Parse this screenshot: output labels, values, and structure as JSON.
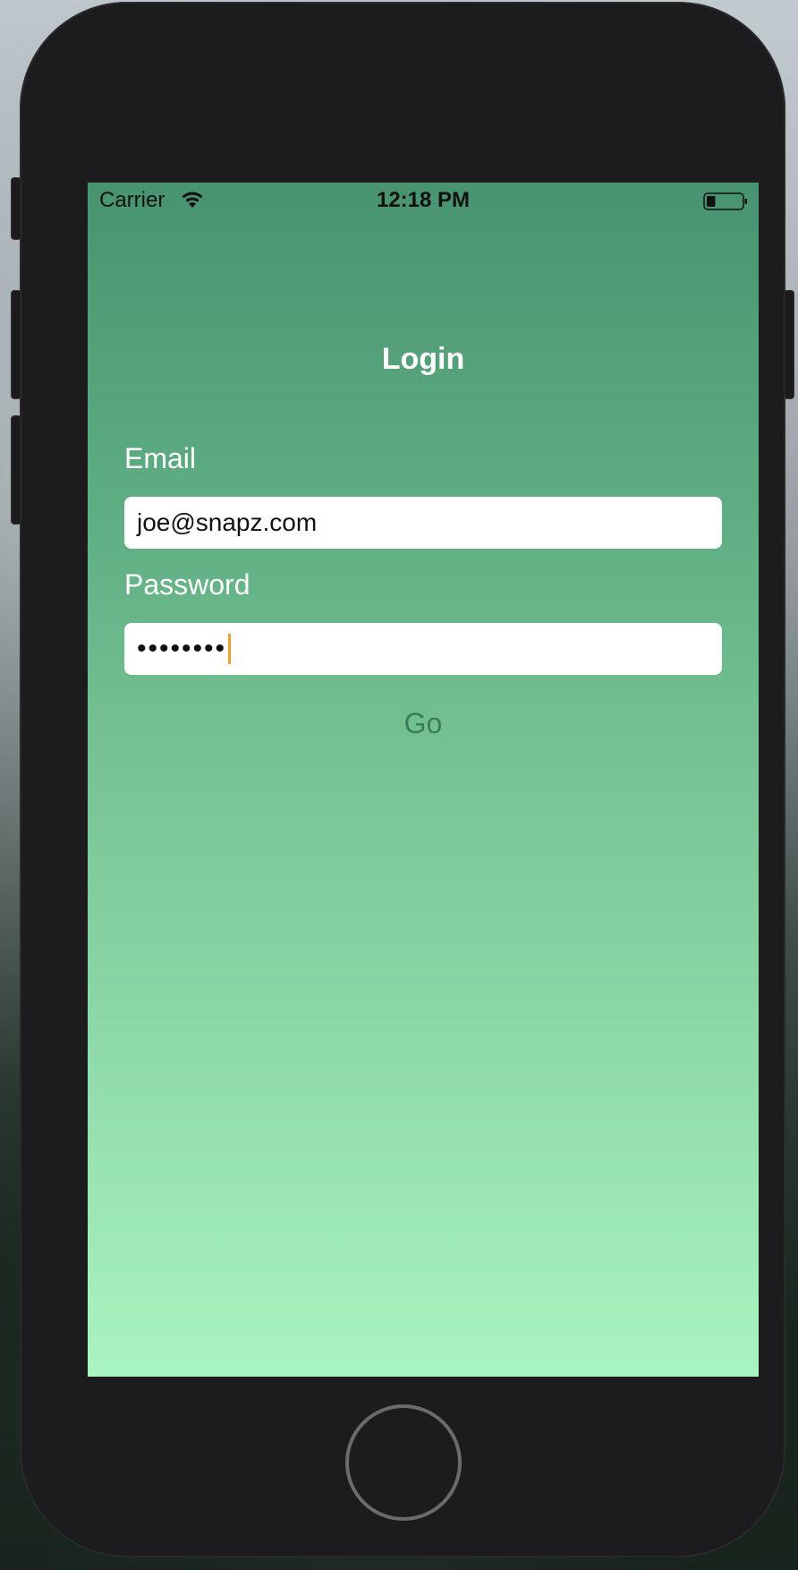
{
  "status_bar": {
    "carrier": "Carrier",
    "time": "12:18 PM",
    "battery_level": 0.25
  },
  "icons": [
    "wifi-icon",
    "battery-icon"
  ],
  "colors": {
    "gradient_top": "#489370",
    "gradient_bottom": "#a9f4bf",
    "go_text": "#3c7c5a",
    "caret": "#f0a030"
  },
  "login": {
    "title": "Login",
    "email_label": "Email",
    "email_value": "joe@snapz.com",
    "password_label": "Password",
    "password_masked": "••••••••",
    "go_label": "Go"
  }
}
